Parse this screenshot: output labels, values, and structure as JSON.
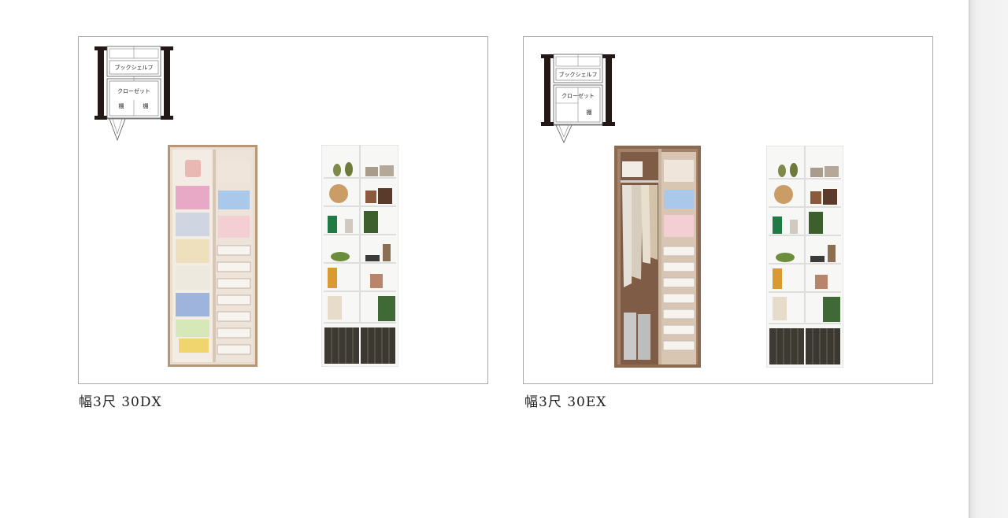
{
  "products": [
    {
      "caption": "幅3尺 30DX",
      "plan": {
        "upper_label": "ブックシェルフ",
        "lower_label": "クローゼット",
        "left_shelf": "棚",
        "right_shelf": "棚"
      }
    },
    {
      "caption": "幅3尺 30EX",
      "plan": {
        "upper_label": "ブックシェルフ",
        "lower_label": "クローゼット",
        "right_shelf": "棚"
      }
    }
  ],
  "colors": {
    "card_border": "#a8a8a8",
    "wood": "#b8967a",
    "wood_dark": "#8c6a52",
    "shelf_white": "#f7f7f5"
  }
}
